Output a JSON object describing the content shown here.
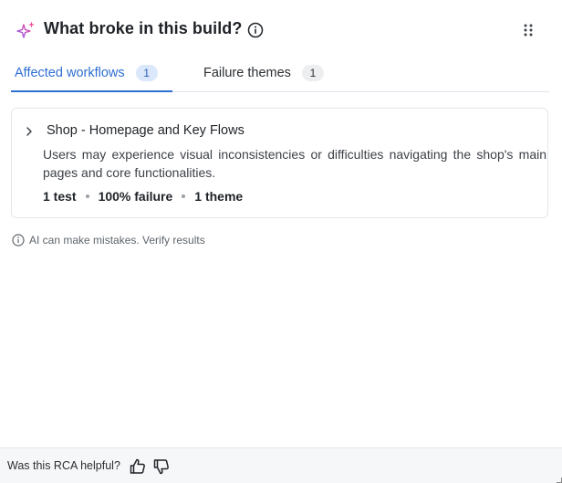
{
  "header": {
    "title": "What broke in this build?",
    "icons": {
      "sparkle": "sparkle-icon",
      "info": "info-icon",
      "drag": "grip-icon"
    },
    "colors": {
      "sparkle_a": "#8b5cf6",
      "sparkle_b": "#ec4899"
    }
  },
  "tabs": [
    {
      "label": "Affected workflows",
      "count": "1",
      "active": true
    },
    {
      "label": "Failure themes",
      "count": "1",
      "active": false
    }
  ],
  "workflow": {
    "title": "Shop - Homepage and Key Flows",
    "description": "Users may experience visual inconsistencies or difficulties navigating the shop's main pages and core functionalities.",
    "stats": {
      "tests": "1 test",
      "failure": "100% failure",
      "themes": "1 theme"
    }
  },
  "disclaimer": "AI can make mistakes. Verify results",
  "footer": {
    "question": "Was this RCA helpful?",
    "icons": {
      "up": "thumbs-up-icon",
      "down": "thumbs-down-icon"
    }
  },
  "colors": {
    "accent": "#2f6fd1",
    "border": "#e3e6ea"
  }
}
